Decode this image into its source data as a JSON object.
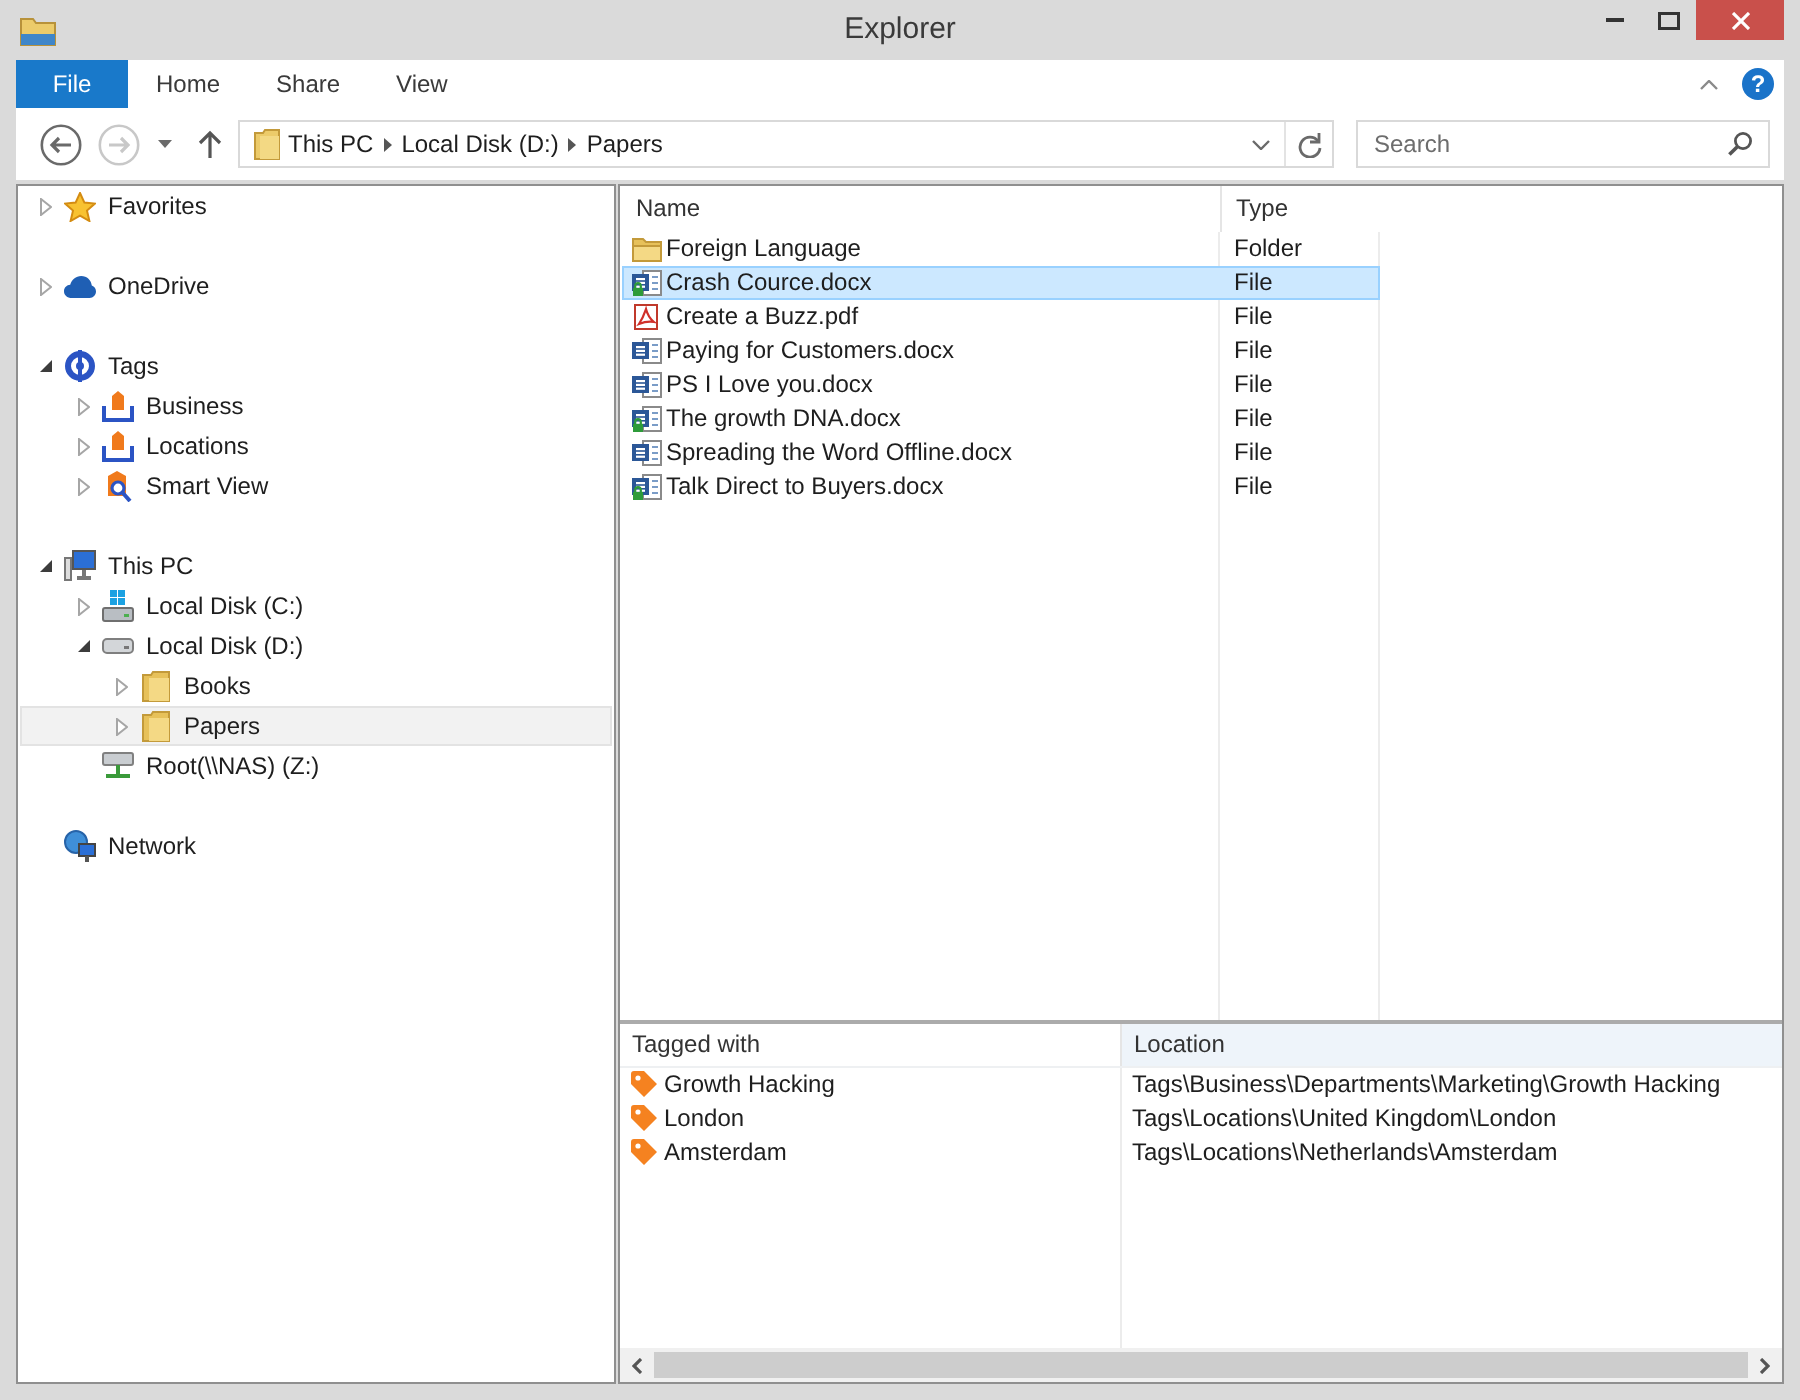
{
  "window": {
    "title": "Explorer"
  },
  "ribbon": {
    "tabs": [
      {
        "label": "File",
        "kind": "file"
      },
      {
        "label": "Home",
        "kind": "tab"
      },
      {
        "label": "Share",
        "kind": "tab"
      },
      {
        "label": "View",
        "kind": "tab"
      }
    ],
    "help": "?"
  },
  "navigation": {
    "buttons": [
      {
        "kind": "back",
        "disabled": false
      },
      {
        "kind": "forward",
        "disabled": true
      }
    ],
    "breadcrumbs": [
      "This PC",
      "Local Disk (D:)",
      "Papers"
    ]
  },
  "search": {
    "placeholder": "Search"
  },
  "navigation_pane": {
    "tree": [
      {
        "label": "Favorites",
        "kind": "favorites",
        "expanded": false,
        "selected": false
      },
      {
        "label": "OneDrive",
        "kind": "cloud",
        "expanded": false,
        "selected": false
      },
      {
        "label": "Tags",
        "kind": "tags",
        "expanded": true,
        "selected": false,
        "children": [
          {
            "label": "Business",
            "kind": "tag-group",
            "expanded": false,
            "selected": false
          },
          {
            "label": "Locations",
            "kind": "tag-group",
            "expanded": false,
            "selected": false
          },
          {
            "label": "Smart View",
            "kind": "smart-view",
            "expanded": false,
            "selected": false
          }
        ]
      },
      {
        "label": "This PC",
        "kind": "pc",
        "expanded": true,
        "selected": false,
        "children": [
          {
            "label": "Local Disk (C:)",
            "kind": "system-disk",
            "expanded": false,
            "selected": false
          },
          {
            "label": "Local Disk (D:)",
            "kind": "disk",
            "expanded": true,
            "selected": false,
            "children": [
              {
                "label": "Books",
                "kind": "folder",
                "expanded": false,
                "selected": false
              },
              {
                "label": "Papers",
                "kind": "folder",
                "expanded": false,
                "selected": true
              }
            ]
          },
          {
            "label": "Root(\\\\NAS) (Z:)",
            "kind": "network-drive",
            "selected": false
          }
        ]
      },
      {
        "label": "Network",
        "kind": "network",
        "selected": false
      }
    ]
  },
  "file_list": {
    "columns": [
      "Name",
      "Type"
    ],
    "rows": [
      {
        "name": "Foreign Language",
        "type": "Folder",
        "kind": "folder",
        "overlay": false,
        "selected": false
      },
      {
        "name": "Crash Cource.docx",
        "type": "File",
        "kind": "document",
        "overlay": true,
        "selected": true
      },
      {
        "name": "Create a Buzz.pdf",
        "type": "File",
        "kind": "pdf",
        "overlay": false,
        "selected": false
      },
      {
        "name": "Paying for Customers.docx",
        "type": "File",
        "kind": "document",
        "overlay": false,
        "selected": false
      },
      {
        "name": "PS I Love you.docx",
        "type": "File",
        "kind": "document",
        "overlay": false,
        "selected": false
      },
      {
        "name": "The growth DNA.docx",
        "type": "File",
        "kind": "document",
        "overlay": true,
        "selected": false
      },
      {
        "name": "Spreading the Word Offline.docx",
        "type": "File",
        "kind": "document",
        "overlay": false,
        "selected": false
      },
      {
        "name": "Talk Direct to Buyers.docx",
        "type": "File",
        "kind": "document",
        "overlay": true,
        "selected": false
      }
    ]
  },
  "tags_panel": {
    "columns": [
      {
        "label": "Tagged with",
        "selected": false
      },
      {
        "label": "Location",
        "selected": true
      }
    ],
    "rows": [
      {
        "tag": "Growth Hacking",
        "location": "Tags\\Business\\Departments\\Marketing\\Growth Hacking"
      },
      {
        "tag": "London",
        "location": "Tags\\Locations\\United Kingdom\\London"
      },
      {
        "tag": "Amsterdam",
        "location": "Tags\\Locations\\Netherlands\\Amsterdam"
      }
    ]
  }
}
